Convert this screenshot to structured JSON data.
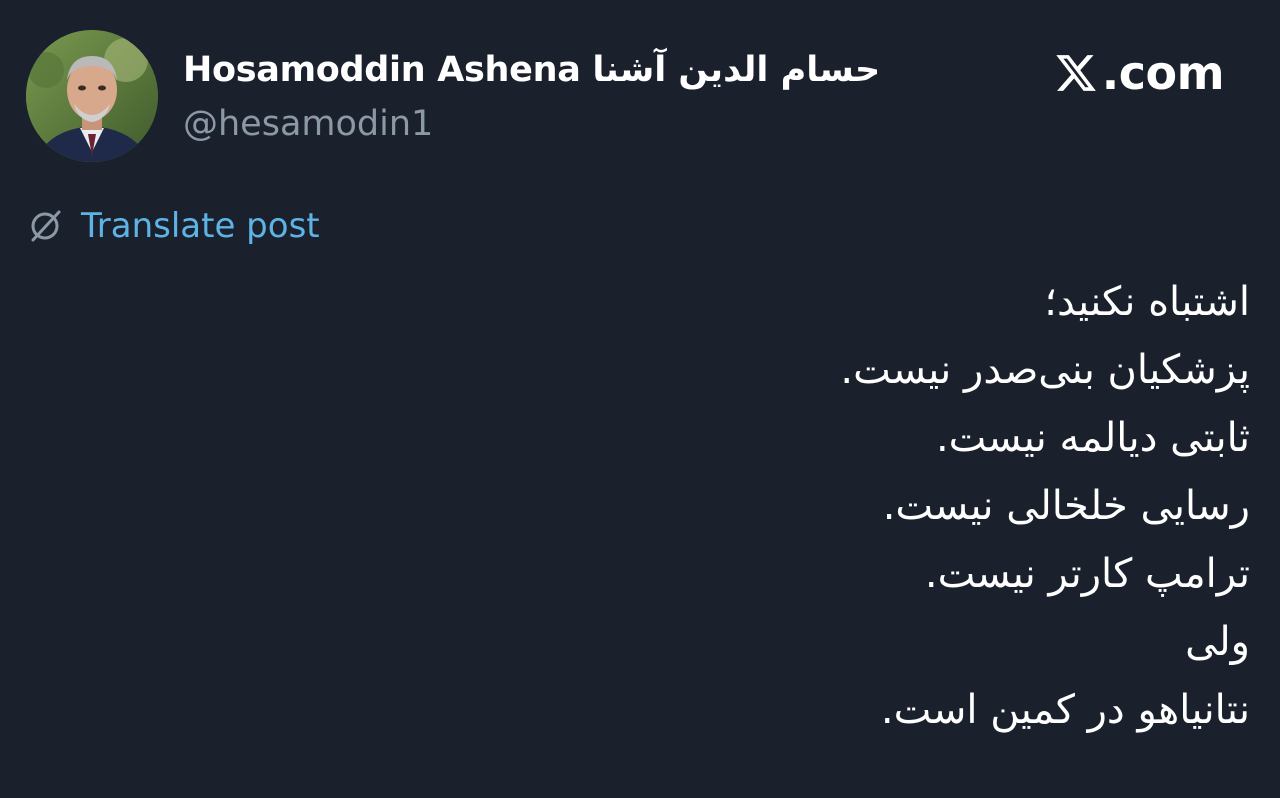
{
  "author": {
    "display_name": "Hosamoddin Ashena حسام الدین آشنا",
    "handle": "@hesamodin1"
  },
  "brand": {
    "text": ".com",
    "icon": "x-logo-icon"
  },
  "translate": {
    "label": "Translate post",
    "icon": "translate-globe-icon"
  },
  "post": {
    "lines": [
      "اشتباه نکنید؛",
      "پزشکیان بنی‌صدر نیست.",
      "ثابتی دیالمه نیست.",
      "رسایی خلخالی نیست.",
      "ترامپ کارتر نیست.",
      "ولی",
      "نتانیاهو  در کمین است."
    ]
  },
  "colors": {
    "background": "#1b212c",
    "text": "#ffffff",
    "secondary_text": "#8b98a5",
    "link": "#5eb3e6"
  }
}
